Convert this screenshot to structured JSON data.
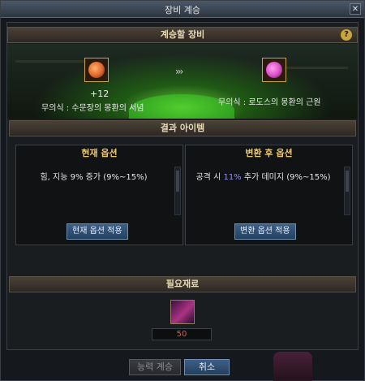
{
  "window": {
    "title": "장비 계승",
    "close_label": "✕"
  },
  "inherit_section": {
    "title": "계승할 장비",
    "help_label": "?"
  },
  "source_item": {
    "plus": "+12",
    "name": "무의식 : 수문장의 몽환의 서념",
    "icon": "ring-icon",
    "color": "#e0642c"
  },
  "target_item": {
    "name": "무의식 : 로도스의 몽환의 근원",
    "icon": "amulet-icon",
    "color": "#d94cc6"
  },
  "arrow": "›››",
  "result_section": {
    "title": "결과 아이템"
  },
  "current_option": {
    "title": "현재 옵션",
    "text_before": "힘, 지능 9% 증가 (9%~15%)",
    "apply_label": "현재 옵션 적용"
  },
  "converted_option": {
    "title": "변환 후 옵션",
    "text_before": "공격 시 ",
    "text_highlight": "11%",
    "text_after": " 추가 데미지 (9%~15%)",
    "apply_label": "변환 옵션 적용"
  },
  "materials_section": {
    "title": "필요재료",
    "material_icon": "stone-icon",
    "count": "50"
  },
  "footer": {
    "inherit_label": "능력 계승",
    "cancel_label": "취소"
  },
  "colors": {
    "accent_gold": "#e8c773",
    "button_blue": "#23405f",
    "count_red": "#e05a3a"
  }
}
